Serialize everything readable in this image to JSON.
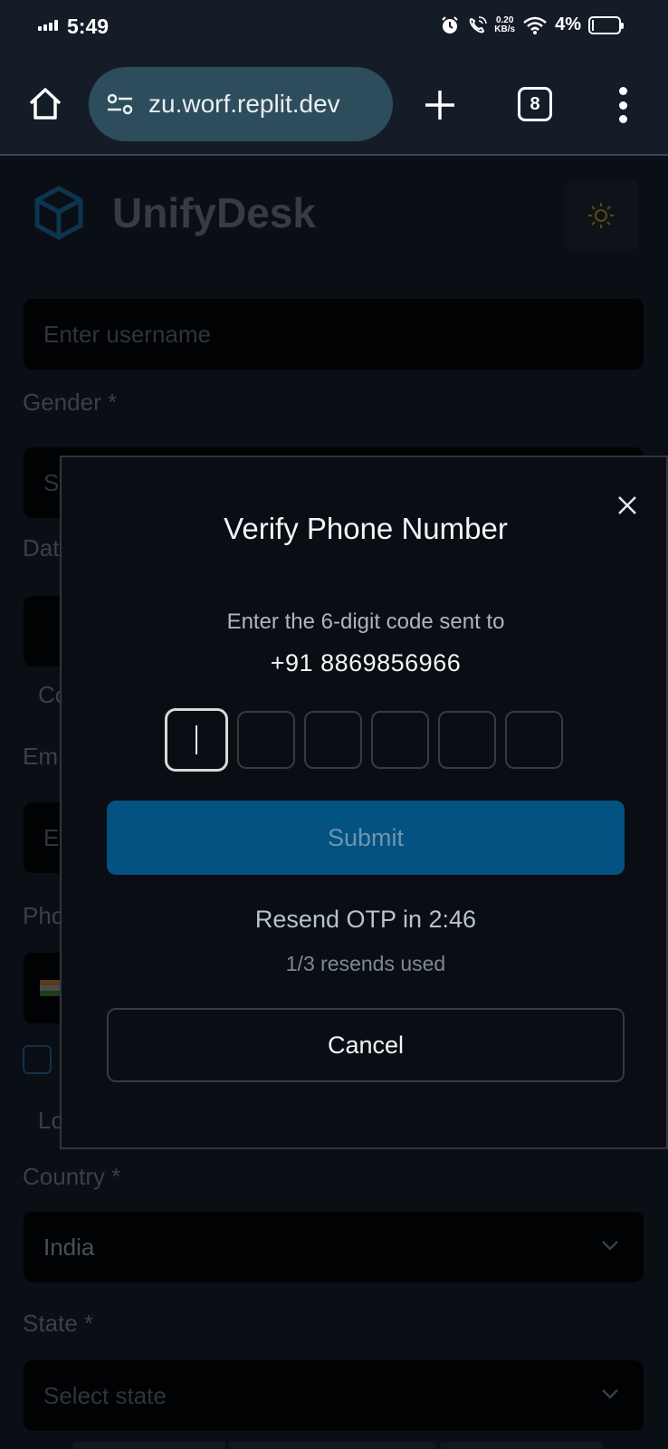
{
  "status_bar": {
    "time": "5:49",
    "net_speed_value": "0.20",
    "net_speed_unit": "KB/s",
    "battery": "4%",
    "icons": [
      "signal-icon",
      "alarm-icon",
      "wifi-calling-icon",
      "wifi-icon",
      "battery-icon"
    ]
  },
  "browser": {
    "url": "zu.worf.replit.dev",
    "tab_count": "8",
    "icons": [
      "home-icon",
      "site-settings-icon",
      "plus-icon",
      "kebab-menu-icon"
    ]
  },
  "background_page": {
    "brand": "UnifyDesk",
    "username_placeholder": "Enter username",
    "gender_label": "Gender *",
    "gender_value_partial": "S",
    "dob_label_partial": "Dat",
    "row_partial_co": "Co",
    "email_label_partial": "Em",
    "email_placeholder_partial": "E",
    "phone_label_partial": "Pho",
    "location_partial": "Lo",
    "country_label": "Country *",
    "country_value": "India",
    "state_label": "State *",
    "state_placeholder": "Select state"
  },
  "modal": {
    "title": "Verify Phone Number",
    "subtitle": "Enter the 6-digit code sent to",
    "phone": "+91 8869856966",
    "submit_label": "Submit",
    "resend_timer": "Resend OTP in 2:46",
    "resend_count": "1/3 resends used",
    "cancel_label": "Cancel"
  },
  "colors": {
    "accent": "#035281",
    "modal_bg": "#0a0d13",
    "toolbar_bg": "#141d27",
    "url_pill": "#2e4d5c"
  }
}
